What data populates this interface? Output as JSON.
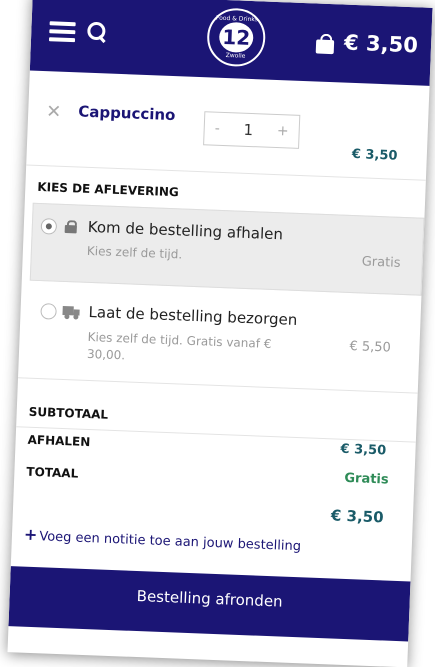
{
  "header": {
    "logo_top": "Food & Drinks",
    "logo_mid": "12",
    "logo_bottom": "Zwolle",
    "cart_total": "€ 3,50"
  },
  "cart_item": {
    "name": "Cappuccino",
    "quantity": "1",
    "decrement": "-",
    "increment": "+",
    "price": "€ 3,50"
  },
  "delivery": {
    "title": "KIES DE AFLEVERING",
    "options": [
      {
        "label": "Kom de bestelling afhalen",
        "sub": "Kies zelf de tijd.",
        "price": "Gratis",
        "selected": true,
        "icon": "lock-icon"
      },
      {
        "label": "Laat de bestelling bezorgen",
        "sub": "Kies zelf de tijd. Gratis vanaf € 30,00.",
        "price": "€ 5,50",
        "selected": false,
        "icon": "truck-icon"
      }
    ]
  },
  "summary": {
    "subtotal_label": "SUBTOTAAL",
    "subtotal_value": "€ 3,50",
    "pickup_label": "AFHALEN",
    "pickup_value": "Gratis",
    "total_label": "TOTAAL",
    "total_value": "€ 3,50"
  },
  "note_link": "Voeg een notitie toe aan jouw bestelling",
  "checkout_button": "Bestelling afronden",
  "colors": {
    "brand": "#1b1575",
    "price": "#1a5b68",
    "free": "#2e8b57"
  }
}
